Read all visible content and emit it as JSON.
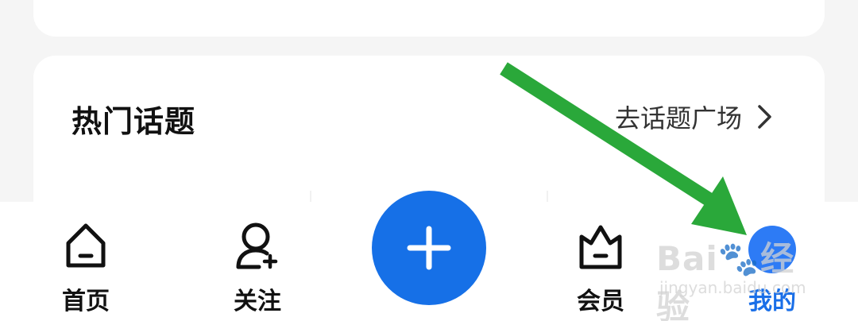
{
  "topics": {
    "title": "热门话题",
    "more_label": "去话题广场"
  },
  "nav": {
    "items": [
      {
        "label": "首页",
        "icon": "home-icon"
      },
      {
        "label": "关注",
        "icon": "add-friend-icon"
      },
      {
        "label": "会员",
        "icon": "crown-icon"
      },
      {
        "label": "我的",
        "icon": "profile-icon",
        "active": true
      }
    ],
    "fab_icon": "plus-icon"
  },
  "watermark": {
    "brand": "Bai",
    "brand_tail": "经验",
    "site": "jingyan.baidu.com"
  },
  "colors": {
    "accent": "#1670e7",
    "active_label": "#1a6fe8",
    "annotation_arrow": "#2aa83a",
    "background": "#f5f5f5",
    "card": "#ffffff"
  }
}
